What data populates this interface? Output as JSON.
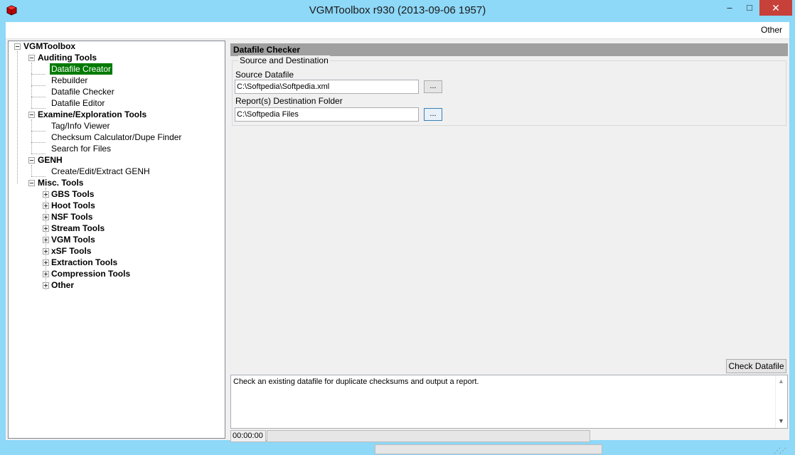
{
  "window": {
    "title": "VGMToolbox r930 (2013-09-06 1957)",
    "min_glyph": "–",
    "max_glyph": "□",
    "close_glyph": "✕"
  },
  "menu": {
    "other_label": "Other"
  },
  "tree": {
    "root": "VGMToolbox",
    "auditing": "Auditing Tools",
    "datafile_creator": "Datafile Creator",
    "rebuilder": "Rebuilder",
    "datafile_checker": "Datafile Checker",
    "datafile_editor": "Datafile Editor",
    "examine": "Examine/Exploration Tools",
    "tag_info": "Tag/Info Viewer",
    "checksum": "Checksum Calculator/Dupe Finder",
    "search_files": "Search for Files",
    "genh": "GENH",
    "genh_create": "Create/Edit/Extract GENH",
    "misc": "Misc. Tools",
    "gbs": "GBS Tools",
    "hoot": "Hoot Tools",
    "nsf": "NSF Tools",
    "stream": "Stream Tools",
    "vgm": "VGM Tools",
    "xsf": "xSF Tools",
    "extraction": "Extraction Tools",
    "compression": "Compression Tools",
    "other": "Other"
  },
  "panel": {
    "header": "Datafile Checker",
    "group_label": "Source and Destination",
    "source_label": "Source Datafile",
    "source_value": "C:\\Softpedia\\Softpedia.xml",
    "dest_label": "Report(s) Destination Folder",
    "dest_value": "C:\\Softpedia Files",
    "browse_label": "...",
    "check_button": "Check Datafile",
    "description": "Check an existing datafile for duplicate checksums and output a report.",
    "timer": "00:00:00"
  },
  "colors": {
    "titlebar": "#8ed8f8",
    "close": "#c7403a",
    "selection": "#007a00",
    "header": "#a0a0a0"
  }
}
